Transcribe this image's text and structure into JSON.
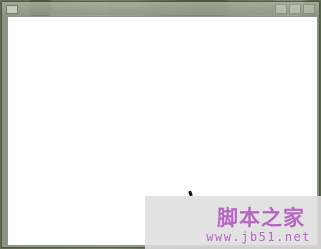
{
  "window": {
    "title": "",
    "icon": "window-icon",
    "controls": [
      "minimize-icon",
      "maximize-icon",
      "close-icon"
    ]
  },
  "content": {
    "state": "blank"
  },
  "watermark": {
    "logo_text": "脚本之家",
    "url": "www.jb51.net",
    "color": "#b866c4"
  },
  "colors": {
    "client_background": "#ffffff",
    "desktop_tint": "#6f7a63"
  }
}
